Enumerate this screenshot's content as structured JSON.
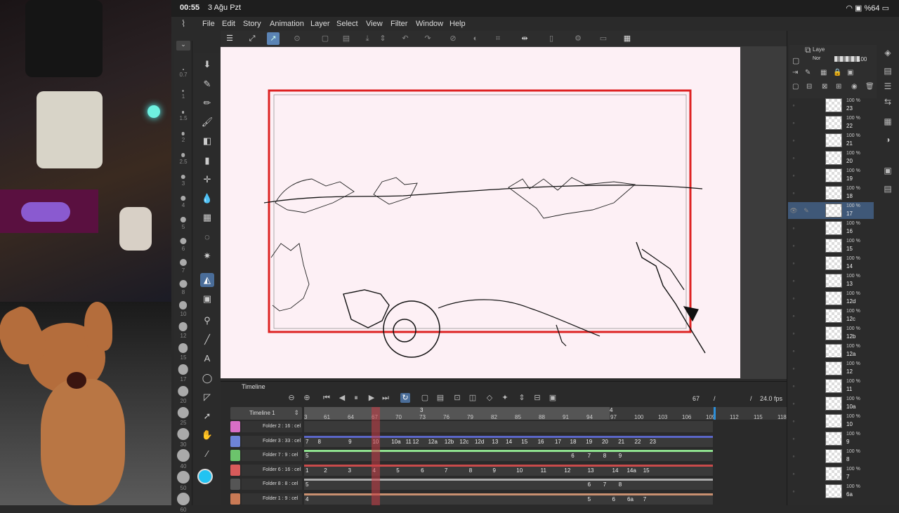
{
  "status_bar": {
    "time": "00:55",
    "date": "3 Ağu Pzt",
    "battery": "%64"
  },
  "menu": [
    "File",
    "Edit",
    "Story",
    "Animation",
    "Layer",
    "Select",
    "View",
    "Filter",
    "Window",
    "Help"
  ],
  "brush_sizes": [
    "0.7",
    "1",
    "1.5",
    "2",
    "2.5",
    "3",
    "4",
    "5",
    "6",
    "7",
    "8",
    "10",
    "12",
    "15",
    "17",
    "20",
    "25",
    "30",
    "40",
    "50",
    "60"
  ],
  "timeline": {
    "title": "Timeline",
    "name": "Timeline 1",
    "current_frame": "67",
    "fps": "24.0 fps",
    "ruler_ticks": [
      "3",
      "61",
      "64",
      "67",
      "70",
      "73",
      "76",
      "79",
      "82",
      "85",
      "88",
      "91",
      "94",
      "97",
      "100",
      "103",
      "106",
      "109",
      "112",
      "115",
      "118"
    ],
    "scene_markers": [
      "3",
      "4"
    ],
    "tracks": [
      {
        "name": "Folder 2 : 16 : cel",
        "color": "#d86ec6",
        "bar": "",
        "cels": [
          {
            "v": ""
          }
        ]
      },
      {
        "name": "Folder 3 : 33 : cel",
        "color": "#6d84d8",
        "bar": "#5a66c7",
        "cels": [
          {
            "v": "7",
            "f": 0
          },
          {
            "v": "8",
            "f": 0.03
          },
          {
            "v": "9",
            "f": 0.105
          },
          {
            "v": "10",
            "f": 0.164
          },
          {
            "v": "10a",
            "f": 0.21
          },
          {
            "v": "11",
            "f": 0.245
          },
          {
            "v": "12",
            "f": 0.262
          },
          {
            "v": "12a",
            "f": 0.3
          },
          {
            "v": "12b",
            "f": 0.34
          },
          {
            "v": "12c",
            "f": 0.377
          },
          {
            "v": "12d",
            "f": 0.414
          },
          {
            "v": "13",
            "f": 0.456
          },
          {
            "v": "14",
            "f": 0.49
          },
          {
            "v": "15",
            "f": 0.528
          },
          {
            "v": "16",
            "f": 0.568
          },
          {
            "v": "17",
            "f": 0.61
          },
          {
            "v": "18",
            "f": 0.647
          },
          {
            "v": "19",
            "f": 0.686
          },
          {
            "v": "20",
            "f": 0.725
          },
          {
            "v": "21",
            "f": 0.765
          },
          {
            "v": "22",
            "f": 0.805
          },
          {
            "v": "23",
            "f": 0.842
          }
        ]
      },
      {
        "name": "Folder 7 : 9 : cel",
        "color": "#6cc46c",
        "bar": "#8ee08e",
        "cels": [
          {
            "v": "5",
            "f": 0
          },
          {
            "v": "6",
            "f": 0.65
          },
          {
            "v": "7",
            "f": 0.69
          },
          {
            "v": "8",
            "f": 0.728
          },
          {
            "v": "9",
            "f": 0.766
          }
        ]
      },
      {
        "name": "Folder 6 : 16 : cel",
        "color": "#d85b5b",
        "bar": "#c94b4b",
        "cels": [
          {
            "v": "1",
            "f": 0
          },
          {
            "v": "2",
            "f": 0.045
          },
          {
            "v": "3",
            "f": 0.104
          },
          {
            "v": "4",
            "f": 0.164
          },
          {
            "v": "5",
            "f": 0.222
          },
          {
            "v": "6",
            "f": 0.282
          },
          {
            "v": "7",
            "f": 0.34
          },
          {
            "v": "8",
            "f": 0.4
          },
          {
            "v": "9",
            "f": 0.458
          },
          {
            "v": "10",
            "f": 0.516
          },
          {
            "v": "11",
            "f": 0.575
          },
          {
            "v": "12",
            "f": 0.633
          },
          {
            "v": "13",
            "f": 0.69
          },
          {
            "v": "14",
            "f": 0.75
          },
          {
            "v": "14a",
            "f": 0.786
          },
          {
            "v": "15",
            "f": 0.826
          }
        ]
      },
      {
        "name": "Folder 8 : 8 : cel",
        "color": "#555555",
        "bar": "#aaaaaa",
        "cels": [
          {
            "v": "5",
            "f": 0
          },
          {
            "v": "6",
            "f": 0.69
          },
          {
            "v": "7",
            "f": 0.728
          },
          {
            "v": "8",
            "f": 0.766
          }
        ]
      },
      {
        "name": "Folder 1 : 9 : cel",
        "color": "#c97a55",
        "bar": "#c99070",
        "cels": [
          {
            "v": "4",
            "f": 0
          },
          {
            "v": "5",
            "f": 0.69
          },
          {
            "v": "6",
            "f": 0.75
          },
          {
            "v": "6a",
            "f": 0.787
          },
          {
            "v": "7",
            "f": 0.826
          }
        ]
      }
    ]
  },
  "layer_panel": {
    "tab": "Laye",
    "blend": "Nor",
    "opacity": "100",
    "layers": [
      {
        "opacity": "100 %",
        "name": "23"
      },
      {
        "opacity": "100 %",
        "name": "22"
      },
      {
        "opacity": "100 %",
        "name": "21"
      },
      {
        "opacity": "100 %",
        "name": "20"
      },
      {
        "opacity": "100 %",
        "name": "19"
      },
      {
        "opacity": "100 %",
        "name": "18"
      },
      {
        "opacity": "100 %",
        "name": "17",
        "selected": true
      },
      {
        "opacity": "100 %",
        "name": "16"
      },
      {
        "opacity": "100 %",
        "name": "15"
      },
      {
        "opacity": "100 %",
        "name": "14"
      },
      {
        "opacity": "100 %",
        "name": "13"
      },
      {
        "opacity": "100 %",
        "name": "12d"
      },
      {
        "opacity": "100 %",
        "name": "12c"
      },
      {
        "opacity": "100 %",
        "name": "12b"
      },
      {
        "opacity": "100 %",
        "name": "12a"
      },
      {
        "opacity": "100 %",
        "name": "12"
      },
      {
        "opacity": "100 %",
        "name": "11"
      },
      {
        "opacity": "100 %",
        "name": "10a"
      },
      {
        "opacity": "100 %",
        "name": "10"
      },
      {
        "opacity": "100 %",
        "name": "9"
      },
      {
        "opacity": "100 %",
        "name": "8"
      },
      {
        "opacity": "100 %",
        "name": "7"
      },
      {
        "opacity": "100 %",
        "name": "6a"
      }
    ]
  },
  "accent_color": "#22c3f2"
}
